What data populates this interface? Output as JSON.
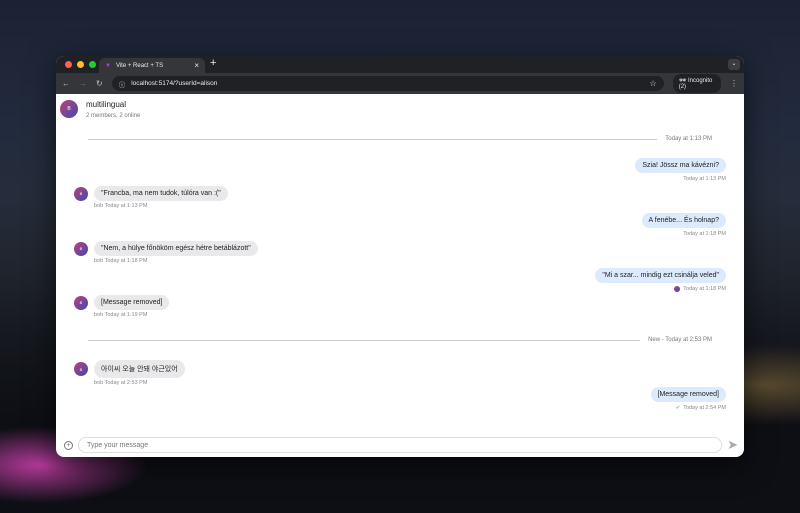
{
  "browser": {
    "tab_title": "Vite + React + TS",
    "url": "localhost:5174/?userId=alison",
    "incognito_label": "Incognito (2)"
  },
  "header": {
    "avatar_initial": "B",
    "title": "multilingual",
    "subtitle": "2 members, 2 online"
  },
  "dividers": [
    "Today at 1:13 PM",
    "New - Today at 2:53 PM"
  ],
  "messages": [
    {
      "dir": "out",
      "text": "Szia! Jössz ma kávézni?",
      "meta": "Today at 1:13 PM"
    },
    {
      "dir": "in",
      "avatar": "B",
      "text": "\"Francba, ma nem tudok, túlóra van :(\"",
      "meta": "bob Today at 1:13 PM"
    },
    {
      "dir": "out",
      "text": "A fenébe... És holnap?",
      "meta": "Today at 1:18 PM"
    },
    {
      "dir": "in",
      "avatar": "B",
      "text": "\"Nem, a hülye főnököm egész hétre betáblázott\"",
      "meta": "bob Today at 1:18 PM"
    },
    {
      "dir": "out",
      "text": "\"Mi a szar... mindig ezt csinálja veled\"",
      "meta": "Today at 1:18 PM"
    },
    {
      "dir": "in",
      "avatar": "B",
      "text": "[Message removed]",
      "meta": "bob Today at 1:19 PM"
    },
    {
      "dir": "in",
      "avatar": "B",
      "text": "아이씨 오늘 안돼 야근있어",
      "meta": "bob Today at 2:53 PM"
    },
    {
      "dir": "out",
      "text": "[Message removed]",
      "meta": "Today at 2:54 PM"
    }
  ],
  "composer": {
    "placeholder": "Type your message"
  }
}
